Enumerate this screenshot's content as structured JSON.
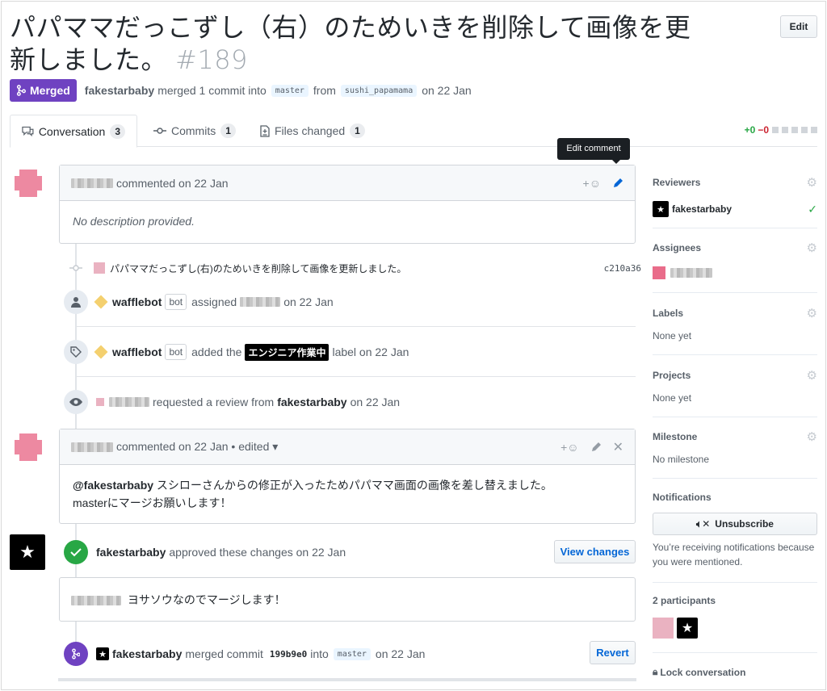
{
  "header": {
    "title": "パパママだっこずし（右）のためいきを削除して画像を更新しました。",
    "number": "#189",
    "edit_label": "Edit"
  },
  "meta": {
    "state_label": "Merged",
    "author": "fakestarbaby",
    "action_text": "merged 1 commit into",
    "base_branch": "master",
    "from_text": "from",
    "head_branch": "sushi_papamama",
    "date_text": "on 22 Jan"
  },
  "tabs": [
    {
      "label": "Conversation",
      "count": "3"
    },
    {
      "label": "Commits",
      "count": "1"
    },
    {
      "label": "Files changed",
      "count": "1"
    }
  ],
  "diffstat": {
    "additions": "+0",
    "deletions": "−0"
  },
  "tooltip": "Edit comment",
  "comment1": {
    "header_text": "commented on 22 Jan",
    "body": "No description provided."
  },
  "commit_event": {
    "message": "パパママだっこずし(右)のためいきを削除して画像を更新しました。",
    "sha": "c210a36"
  },
  "assign_event": {
    "actor": "wafflebot",
    "bot_label": "bot",
    "text_before": "assigned",
    "text_after": "on 22 Jan"
  },
  "label_event": {
    "actor": "wafflebot",
    "bot_label": "bot",
    "text_before": "added the",
    "label_name": "エンジニア作業中",
    "text_after": "label on 22 Jan"
  },
  "review_request_event": {
    "text": "requested a review from",
    "reviewer": "fakestarbaby",
    "date": "on 22 Jan"
  },
  "comment2": {
    "header_text": "commented on 22 Jan • edited ▾",
    "mention": "@fakestarbaby",
    "line1": "スシローさんからの修正が入ったためパパママ画面の画像を差し替えました。",
    "line2": "masterにマージお願いします！"
  },
  "approve_event": {
    "actor": "fakestarbaby",
    "text": "approved these changes on 22 Jan",
    "button": "View changes"
  },
  "review_comment": {
    "body": "ヨサソウなのでマージします！"
  },
  "merge_event": {
    "actor": "fakestarbaby",
    "text": "merged commit",
    "sha": "199b9e0",
    "into": "into",
    "branch": "master",
    "date": "on 22 Jan",
    "button": "Revert"
  },
  "sidebar": {
    "reviewers": {
      "heading": "Reviewers",
      "name": "fakestarbaby"
    },
    "assignees": {
      "heading": "Assignees"
    },
    "labels": {
      "heading": "Labels",
      "value": "None yet"
    },
    "projects": {
      "heading": "Projects",
      "value": "None yet"
    },
    "milestone": {
      "heading": "Milestone",
      "value": "No milestone"
    },
    "notifications": {
      "heading": "Notifications",
      "button": "Unsubscribe",
      "note": "You’re receiving notifications because you were mentioned."
    },
    "participants": {
      "heading": "2 participants"
    },
    "lock": "Lock conversation"
  },
  "icons": [
    "merge-icon",
    "comment-icon",
    "commit-icon",
    "file-diff-icon",
    "smiley-icon",
    "pencil-icon",
    "close-icon",
    "person-icon",
    "tag-icon",
    "eye-icon",
    "check-icon",
    "gear-icon",
    "mute-icon",
    "lock-icon"
  ],
  "colors": {
    "merged": "#6f42c1",
    "approved": "#28a745",
    "link": "#0366d6",
    "deletion": "#cb2431"
  }
}
